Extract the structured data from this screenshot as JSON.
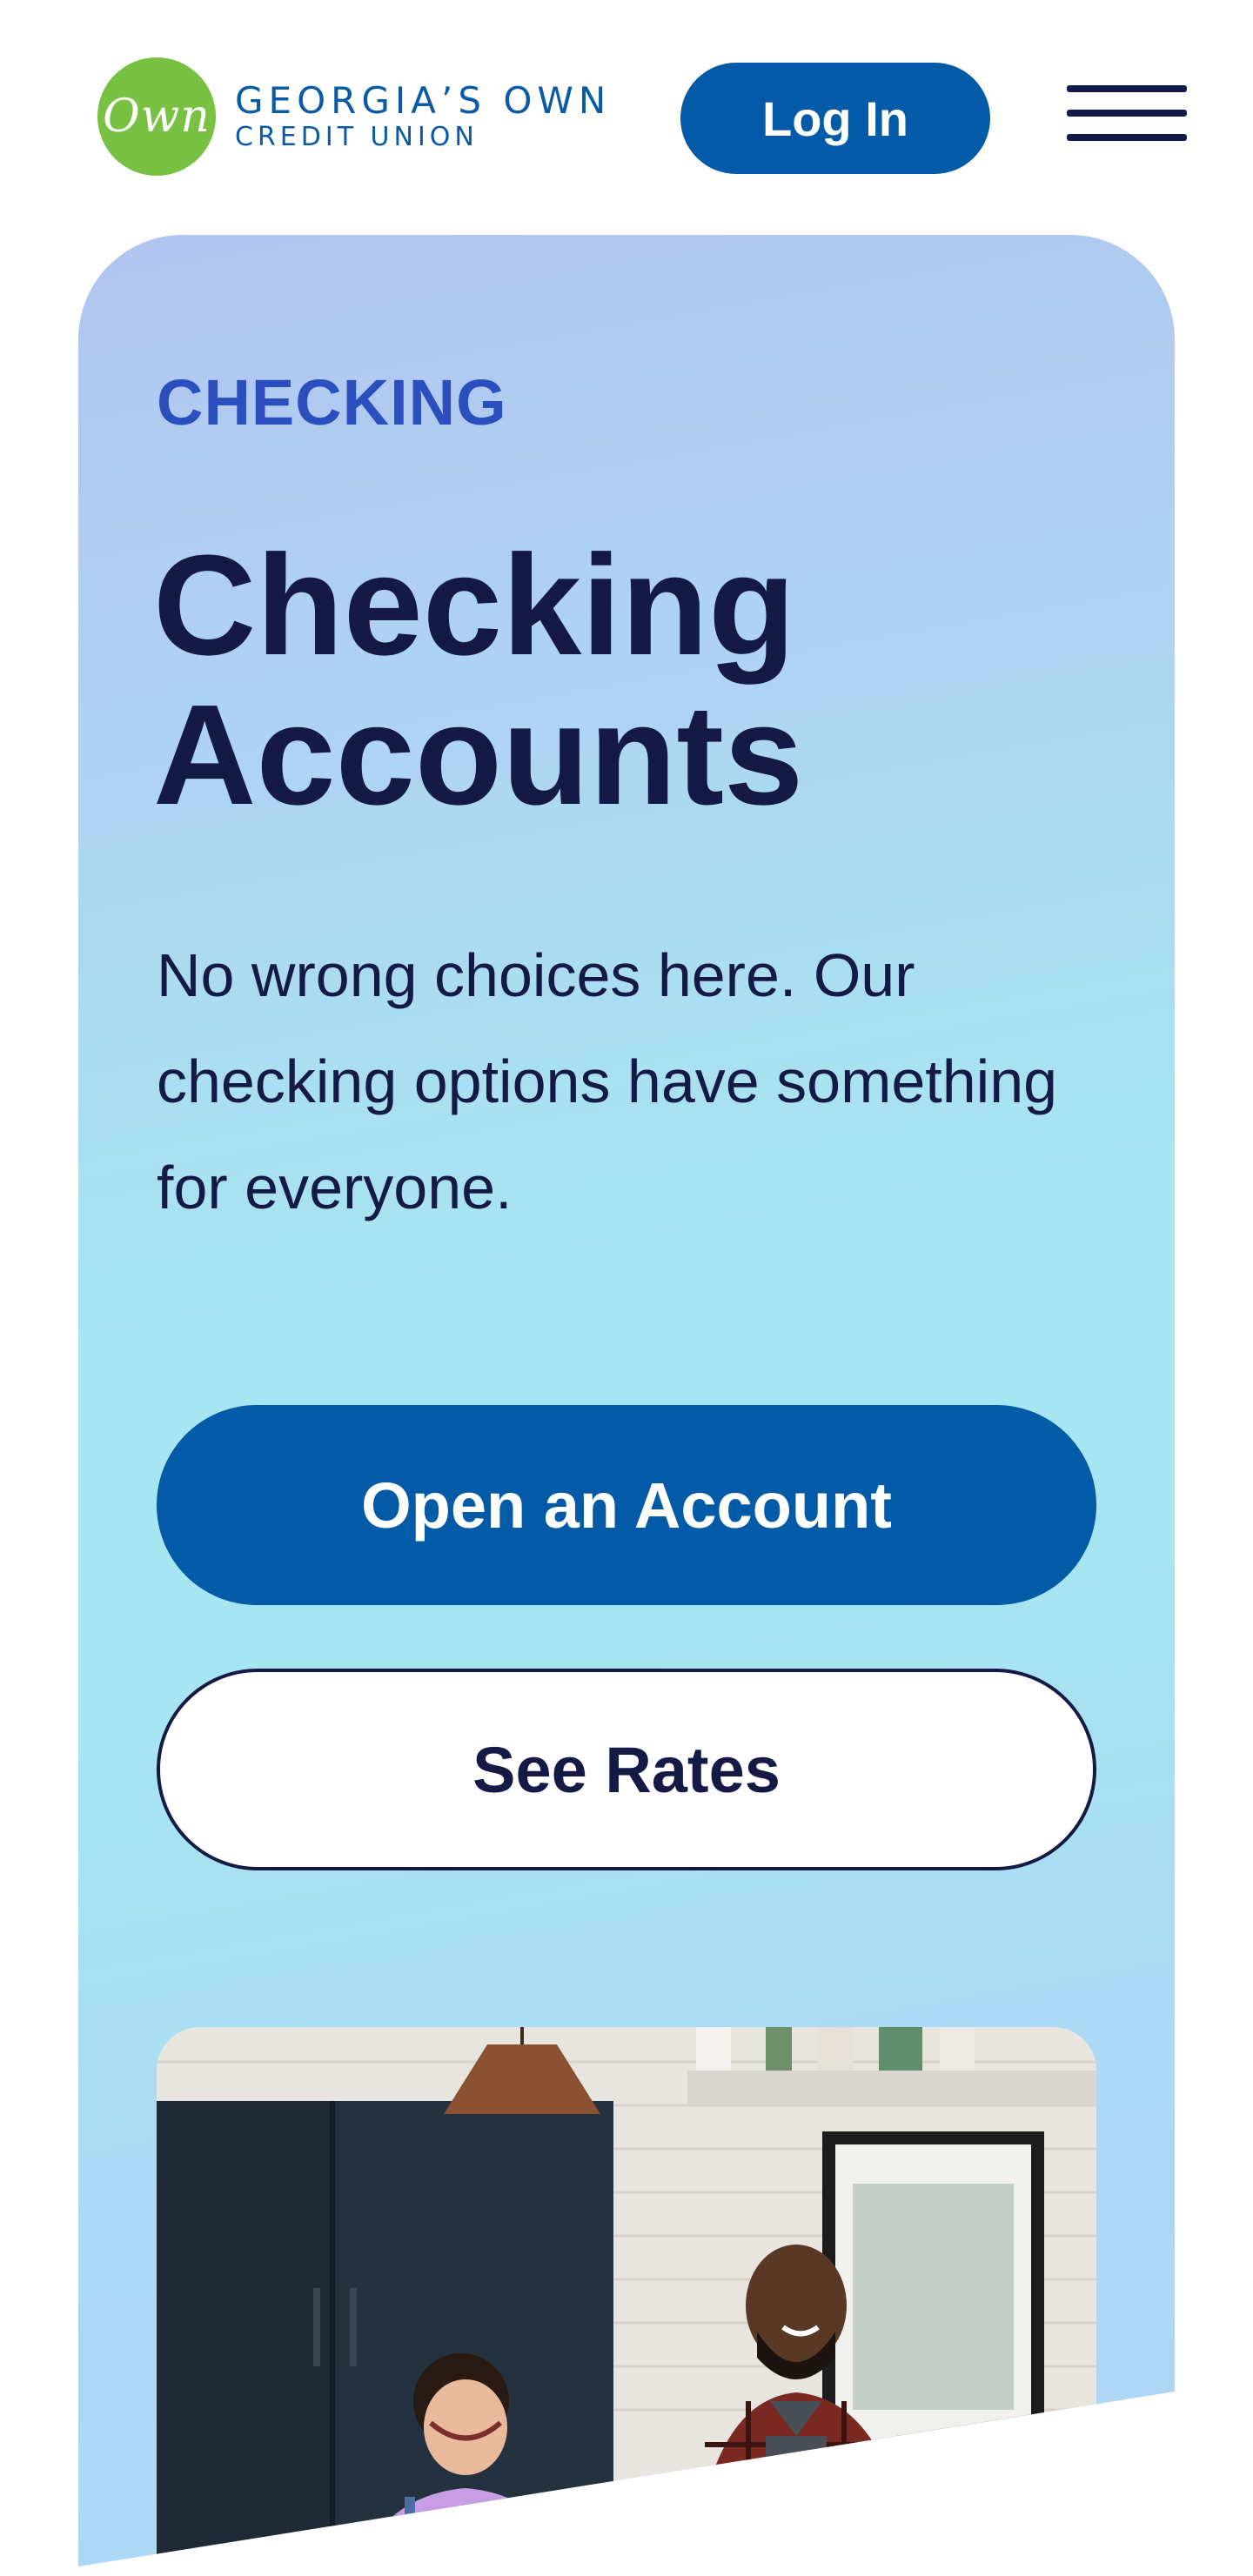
{
  "header": {
    "logo_mark_text": "Own",
    "logo_line1": "GEORGIA’S OWN",
    "logo_line2": "CREDIT UNION",
    "login_label": "Log In",
    "menu_icon": "hamburger-menu-icon"
  },
  "hero": {
    "eyebrow": "CHECKING",
    "title": "Checking\nAccounts",
    "body": "No wrong choices here. Our checking options have something for everyone.",
    "primary_cta": "Open an Account",
    "secondary_cta": "See Rates",
    "image_description_icon": "photo-two-people-laughing-in-kitchen"
  },
  "colors": {
    "brand_blue": "#035aa6",
    "brand_green": "#78c142",
    "navy_text": "#141a45",
    "eyebrow_blue": "#2c4fbf"
  }
}
